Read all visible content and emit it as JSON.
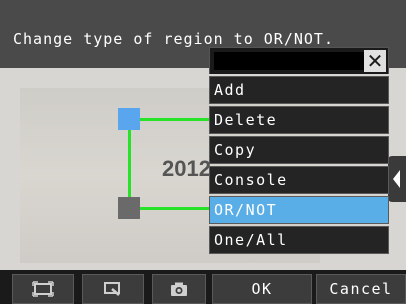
{
  "header": {
    "message": "Change type of region to OR/NOT."
  },
  "viewport": {
    "image_text": "2012"
  },
  "menu": {
    "close_label": "✕",
    "items": [
      {
        "label": "Add",
        "selected": false
      },
      {
        "label": "Delete",
        "selected": false
      },
      {
        "label": "Copy",
        "selected": false
      },
      {
        "label": "Console",
        "selected": false
      },
      {
        "label": "OR/NOT",
        "selected": true
      },
      {
        "label": "One/All",
        "selected": false
      }
    ]
  },
  "toolbar": {
    "buttons": [
      {
        "icon": "fit-screen-icon"
      },
      {
        "icon": "zoom-region-icon"
      },
      {
        "icon": "camera-icon"
      }
    ],
    "ok_label": "OK",
    "cancel_label": "Cancel"
  },
  "colors": {
    "accent": "#5aaee8",
    "region_line": "#27e327",
    "handle_active": "#5aa6ee",
    "handle_inactive": "#6a6a6a"
  }
}
